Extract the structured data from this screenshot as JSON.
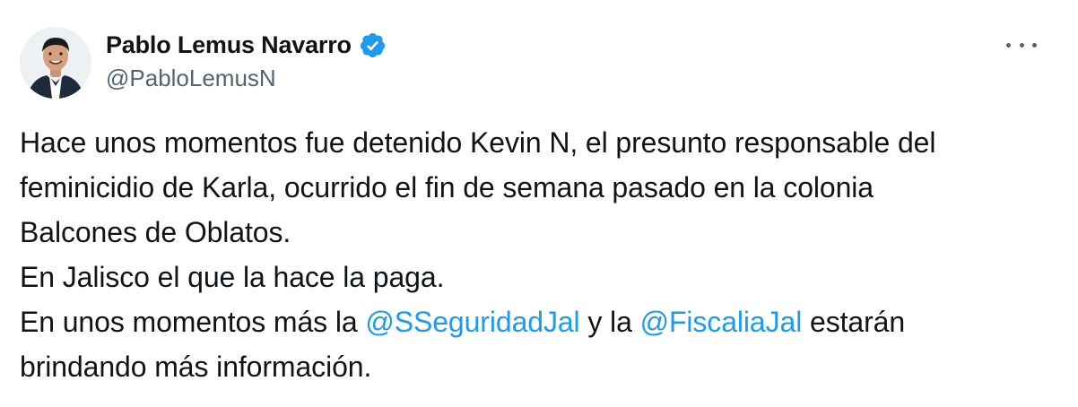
{
  "author": {
    "display_name": "Pablo Lemus Navarro",
    "handle": "@PabloLemusN",
    "verified": true,
    "verified_color": "#1d9bf0"
  },
  "icons": {
    "more": "more-horizontal-icon",
    "verified": "verified-badge-icon"
  },
  "tweet": {
    "line1": "Hace unos momentos fue detenido Kevin N, el presunto responsable del",
    "line2": "feminicidio de Karla, ocurrido el fin de semana pasado en la colonia",
    "line3": "Balcones de Oblatos.",
    "line4": "En Jalisco el que la hace la paga.",
    "line5_prefix": "En unos momentos más la ",
    "mention1": "@SSeguridadJal",
    "line5_middle": " y la ",
    "mention2": "@FiscaliaJal",
    "line5_suffix": " estarán",
    "line6": "brindando más información."
  },
  "colors": {
    "text": "#0f1419",
    "secondary": "#536471",
    "link": "#1d9bf0"
  }
}
